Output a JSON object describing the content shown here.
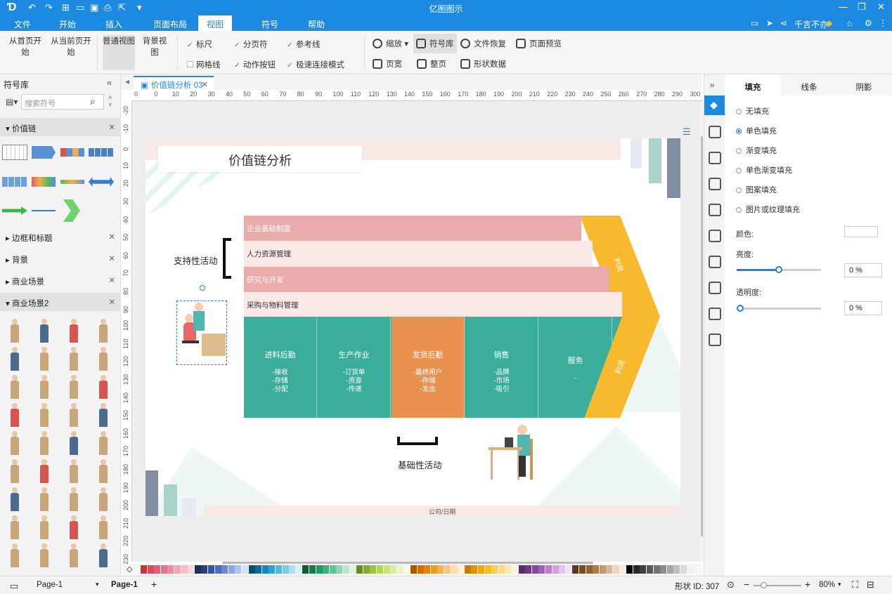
{
  "app_title": "亿图图示",
  "menus": [
    "文件",
    "开始",
    "插入",
    "页面布局",
    "视图",
    "符号",
    "帮助"
  ],
  "active_menu": "视图",
  "user": {
    "name": "千言不亦"
  },
  "ribbon": {
    "from_first": "从首页开始",
    "from_current": "从当前页开始",
    "normal_view": "普通视图",
    "bg_view": "背景视图",
    "ruler": "标尺",
    "gridline": "网格线",
    "page_break": "分页符",
    "action_button": "动作按钮",
    "guide": "参考线",
    "fast_connect": "极速连接模式",
    "zoom": "缩放",
    "page_width": "页宽",
    "symbol_lib": "符号库",
    "full_page": "整页",
    "file_recover": "文件恢复",
    "shape_data": "形状数据",
    "page_preview": "页面预览"
  },
  "left_panel": {
    "title": "符号库",
    "search_placeholder": "搜索符号",
    "categories": [
      "价值链",
      "边框和标题",
      "背景",
      "商业场景",
      "商业场景2"
    ]
  },
  "doc_tab": "价值链分析 03",
  "ruler_h": [
    "0",
    "0",
    "10",
    "20",
    "30",
    "40",
    "50",
    "60",
    "70",
    "80",
    "90",
    "100",
    "110",
    "120",
    "130",
    "140",
    "150",
    "160",
    "170",
    "180",
    "190",
    "200",
    "210",
    "220",
    "230",
    "240",
    "250",
    "260",
    "270",
    "280",
    "290",
    "300"
  ],
  "ruler_v": [
    "-20",
    "-10",
    "0",
    "10",
    "20",
    "30",
    "40",
    "50",
    "60",
    "70",
    "80",
    "90",
    "100",
    "110",
    "120",
    "130",
    "140",
    "150",
    "160",
    "170",
    "180",
    "190",
    "200",
    "210",
    "220",
    "230"
  ],
  "diagram": {
    "title": "价值链分析",
    "support_label": "支持性活动",
    "base_label": "基础性活动",
    "footer": "公司/日期",
    "rows": [
      "企业基础制度",
      "人力资源管理",
      "研究与开发",
      "采购与物料管理"
    ],
    "columns": [
      {
        "title": "进料后勤",
        "items": [
          "-接收",
          "-存储",
          "-分配"
        ],
        "color": "#3aad9b"
      },
      {
        "title": "生产作业",
        "items": [
          "-订货单",
          "-资源",
          "-传递"
        ],
        "color": "#3aad9b"
      },
      {
        "title": "发货后勤",
        "items": [
          "-最终用户",
          "-存储",
          "-发出"
        ],
        "color": "#e9924f"
      },
      {
        "title": "销售",
        "items": [
          "-品牌",
          "-市场",
          "-吸引"
        ],
        "color": "#3aad9b"
      },
      {
        "title": "服务",
        "items": [
          "-"
        ],
        "color": "#3aad9b"
      }
    ],
    "arrow_top": "利润",
    "arrow_bottom": "利润"
  },
  "props": {
    "tabs": [
      "填充",
      "线条",
      "阴影"
    ],
    "fill_options": [
      "无填充",
      "单色填充",
      "渐变填充",
      "单色渐变填充",
      "图案填充",
      "图片或纹理填充"
    ],
    "selected_fill": "单色填充",
    "color_label": "颜色:",
    "brightness_label": "亮度:",
    "brightness_value": "0 %",
    "transparency_label": "透明度:",
    "transparency_value": "0 %"
  },
  "status": {
    "page_selector": "Page-1",
    "page_tab": "Page-1",
    "shape_id": "形状 ID:  307",
    "zoom": "80%"
  },
  "colors": {
    "brand": "#1b8ae0",
    "pink_dark": "#eaabab",
    "pink_light": "#f9e8e6",
    "teal": "#3aad9b",
    "orange": "#e9924f",
    "yellow": "#f8b92e"
  }
}
